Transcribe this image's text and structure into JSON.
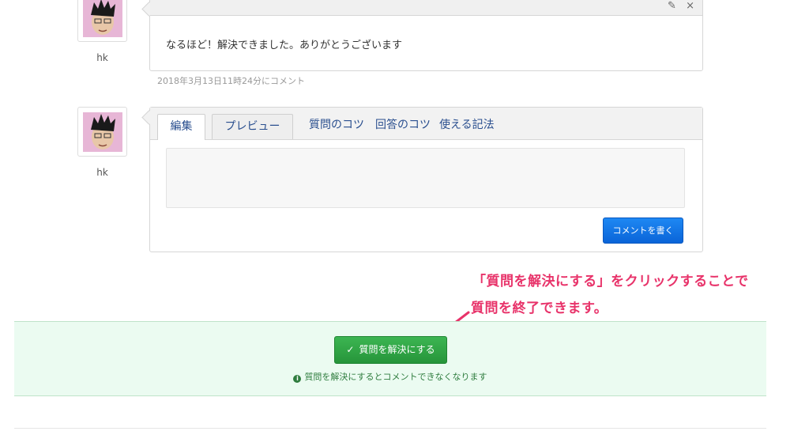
{
  "comment": {
    "author": "hk",
    "text": "なるほど！解決できました。ありがとうございます",
    "timestamp": "2018年3月13日11時24分にコメント",
    "edit_icon": "pencil-icon",
    "delete_icon": "close-icon",
    "edit_glyph": "✎",
    "delete_glyph": "×"
  },
  "composer": {
    "author": "hk",
    "tabs": [
      {
        "label": "編集",
        "active": true
      },
      {
        "label": "プレビュー",
        "active": false
      }
    ],
    "links": [
      "質問のコツ",
      "回答のコツ",
      "使える記法"
    ],
    "editor_value": "",
    "submit_label": "コメントを書く"
  },
  "annotation": {
    "line1": "「質問を解決にする」をクリックすることで",
    "line2": "質問を終了できます。",
    "color": "#e8336a"
  },
  "resolve": {
    "button_label": "質問を解決にする",
    "button_icon": "check-icon",
    "button_glyph": "✓",
    "note": "質問を解決にするとコメントできなくなります",
    "note_icon": "info-icon",
    "note_glyph": "i",
    "accent": "#2f9e44",
    "panel_bg": "#ebfbf1"
  }
}
